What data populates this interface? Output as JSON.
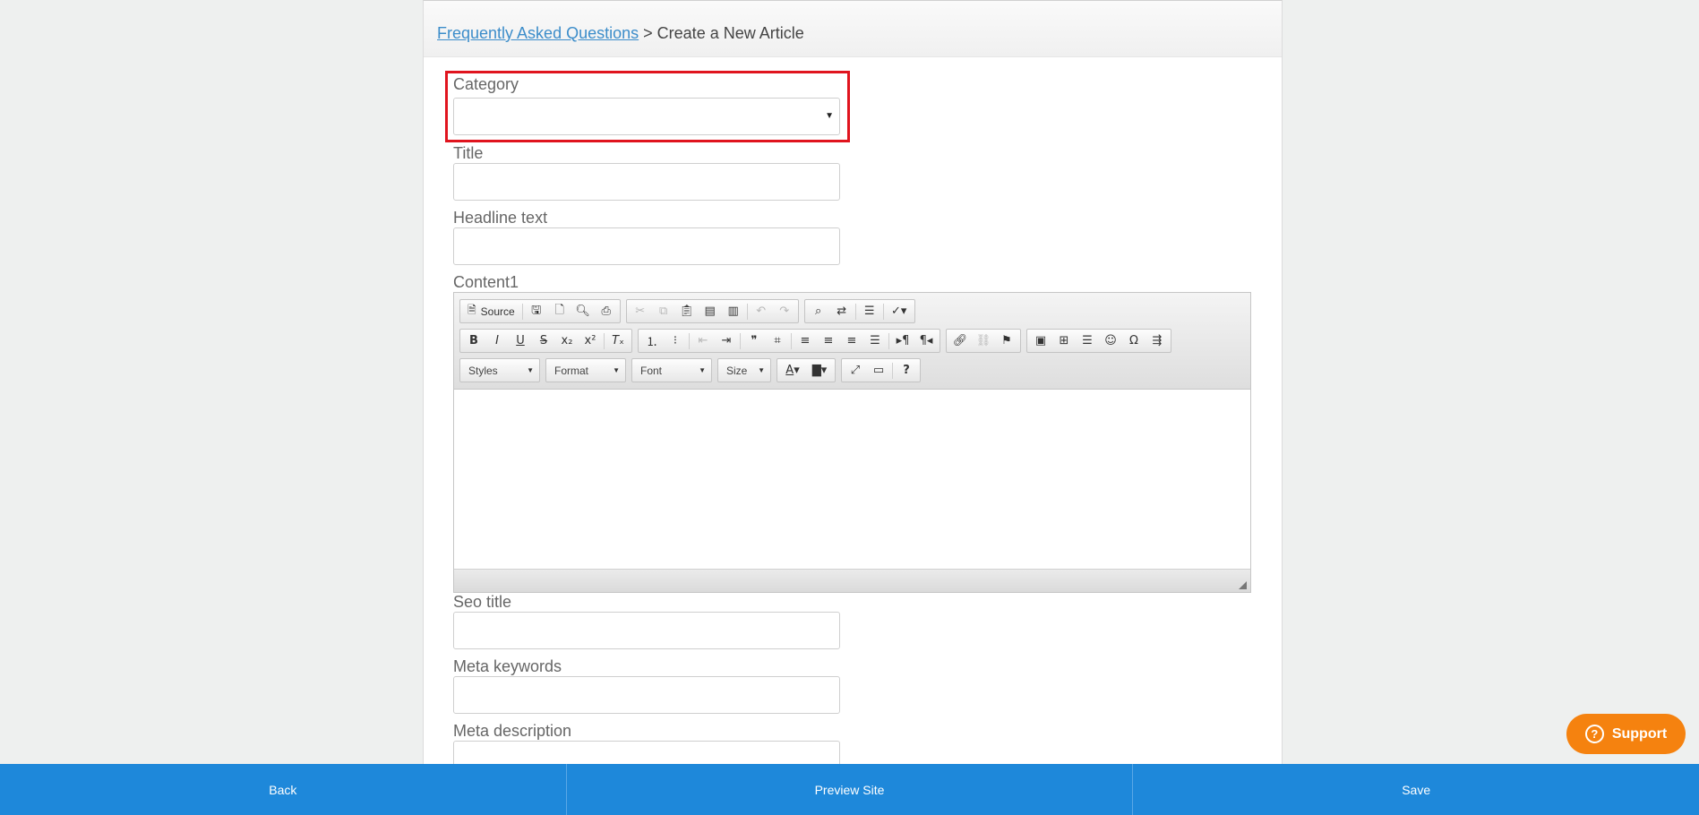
{
  "breadcrumb": {
    "parent": "Frequently Asked Questions",
    "separator": ">",
    "current": "Create a New Article"
  },
  "form": {
    "category_label": "Category",
    "category_value": "",
    "title_label": "Title",
    "headline_label": "Headline text",
    "content_label": "Content1",
    "seo_title_label": "Seo title",
    "meta_keywords_label": "Meta keywords",
    "meta_description_label": "Meta description"
  },
  "editor": {
    "source_label": "Source",
    "styles_label": "Styles",
    "format_label": "Format",
    "font_label": "Font",
    "size_label": "Size"
  },
  "footer": {
    "back_label": "Back",
    "preview_label": "Preview Site",
    "save_label": "Save"
  },
  "support": {
    "label": "Support"
  },
  "colors": {
    "footer_bg": "#1e88da",
    "support_bg": "#f5820f",
    "highlight": "#e0141e",
    "link": "#3c8dca"
  }
}
